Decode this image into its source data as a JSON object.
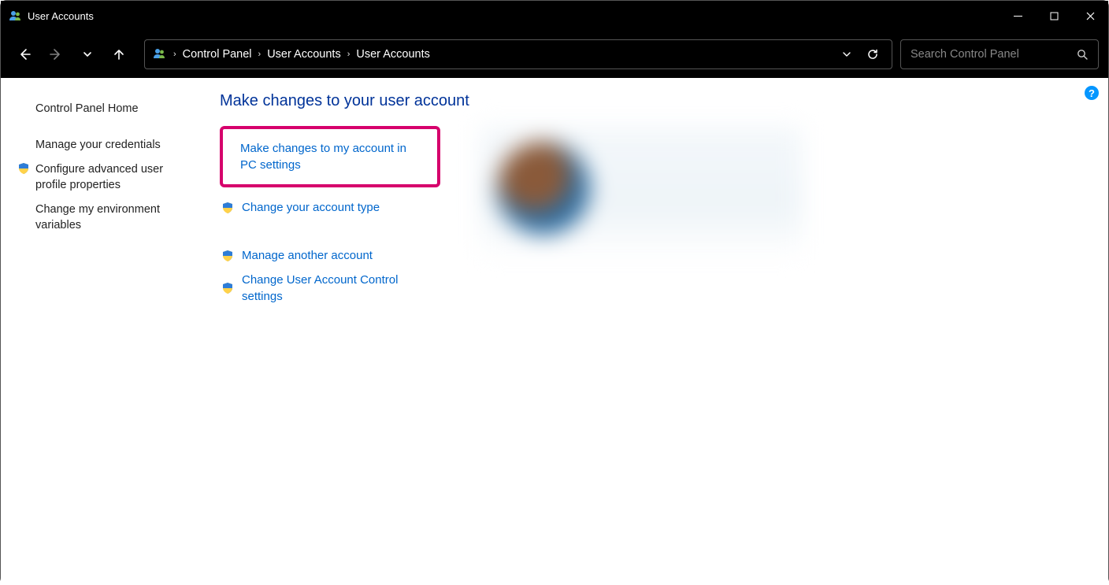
{
  "titlebar": {
    "title": "User Accounts"
  },
  "breadcrumbs": {
    "root": "Control Panel",
    "mid": "User Accounts",
    "leaf": "User Accounts"
  },
  "search": {
    "placeholder": "Search Control Panel"
  },
  "sidebar": {
    "home": "Control Panel Home",
    "items": [
      {
        "label": "Manage your credentials",
        "shield": false
      },
      {
        "label": "Configure advanced user profile properties",
        "shield": true
      },
      {
        "label": "Change my environment variables",
        "shield": false
      }
    ]
  },
  "main": {
    "heading": "Make changes to your user account",
    "highlighted": "Make changes to my account in PC settings",
    "options1": [
      {
        "label": "Change your account type",
        "shield": true
      }
    ],
    "options2": [
      {
        "label": "Manage another account",
        "shield": true
      },
      {
        "label": "Change User Account Control settings",
        "shield": true
      }
    ]
  },
  "help": "?"
}
